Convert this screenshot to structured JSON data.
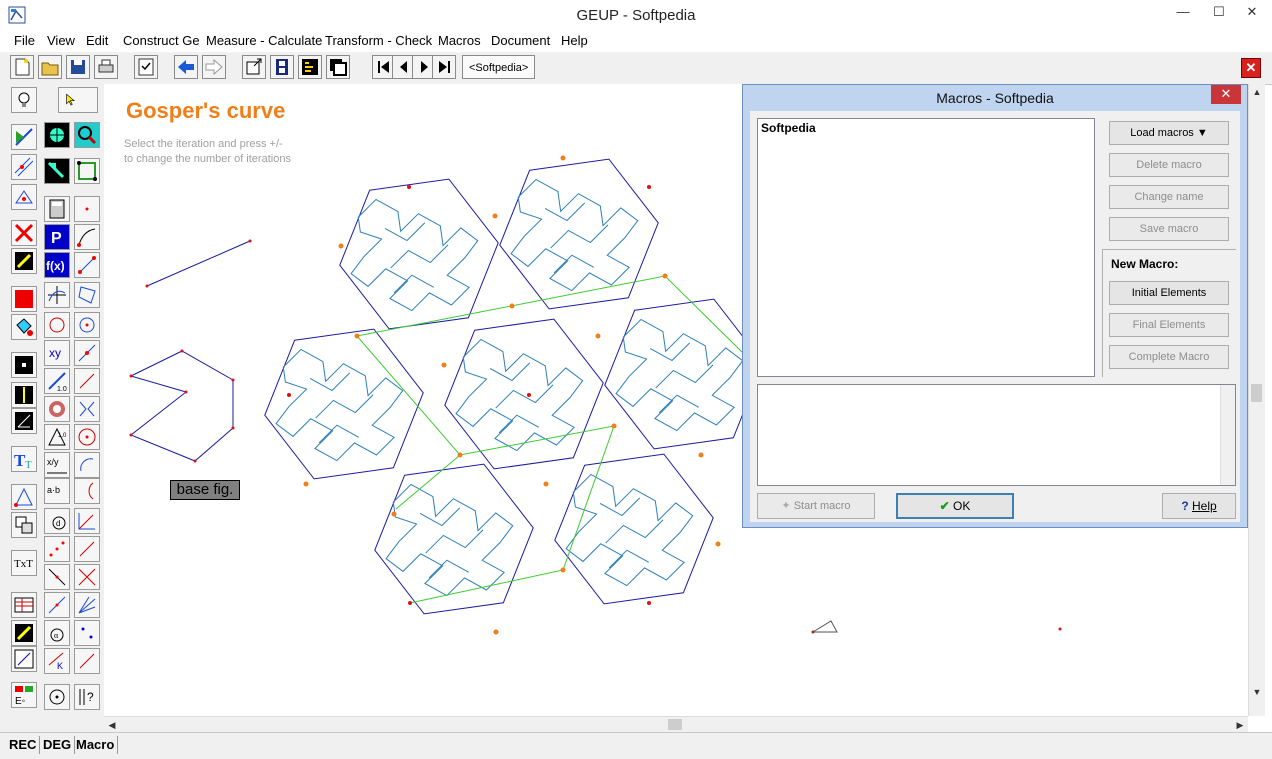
{
  "window": {
    "title": "GEUP - Softpedia",
    "minimize": "—",
    "maximize": "☐",
    "close": "✕"
  },
  "menu": [
    "File",
    "View",
    "Edit",
    "Construct Ge",
    "Measure - Calculate",
    "Transform - Check",
    "Macros",
    "Document",
    "Help"
  ],
  "toolbar": {
    "document_tab": "<Softpedia>",
    "close_doc": "✕"
  },
  "canvas": {
    "heading": "Gosper's curve",
    "hint_line1": "Select the iteration and press +/-",
    "hint_line2": "to change the number of iterations",
    "base_label": "base fig."
  },
  "status": [
    "REC",
    "DEG",
    "Macro"
  ],
  "dialog": {
    "title": "Macros - Softpedia",
    "close": "✕",
    "macros": [
      "Softpedia"
    ],
    "buttons": {
      "load": "Load macros ▼",
      "delete": "Delete macro",
      "change": "Change name",
      "save": "Save macro",
      "initial": "Initial Elements",
      "final": "Final Elements",
      "complete": "Complete Macro",
      "start": "Start macro",
      "ok": "OK",
      "help": "Help"
    },
    "new_macro_label": "New Macro:"
  },
  "colors": {
    "accent": "#f07f1a",
    "hexagon": "#1a1aa0",
    "curve": "#2c7fb8",
    "green": "#3ccc30",
    "point": "#e01010"
  }
}
